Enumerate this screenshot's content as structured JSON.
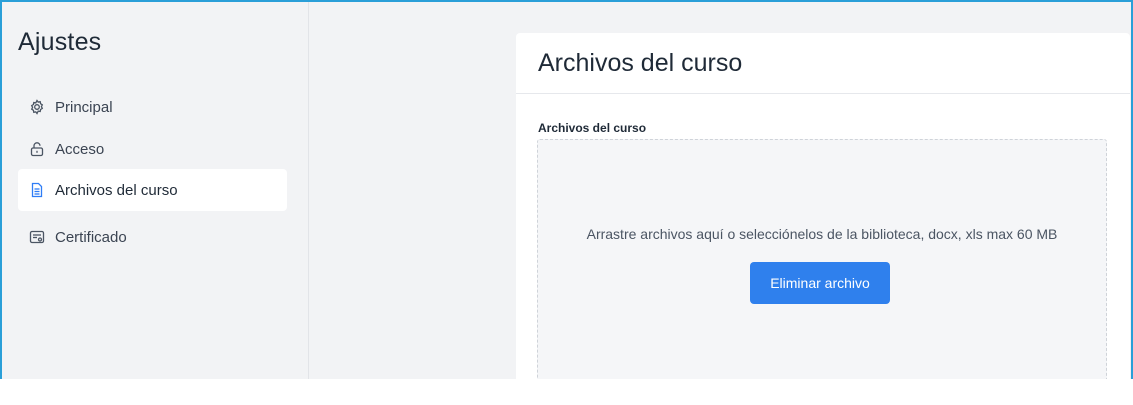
{
  "sidebar": {
    "title": "Ajustes",
    "items": [
      {
        "label": "Principal",
        "icon": "gear-icon",
        "active": false
      },
      {
        "label": "Acceso",
        "icon": "lock-icon",
        "active": false
      },
      {
        "label": "Archivos del curso",
        "icon": "document-icon",
        "active": true
      },
      {
        "label": "Certificado",
        "icon": "certificate-icon",
        "active": false
      }
    ]
  },
  "main": {
    "title": "Archivos del curso",
    "field_label": "Archivos del curso",
    "dropzone": {
      "text": "Arrastre archivos aquí o selecciónelos de la biblioteca, docx, xls max 60 MB",
      "button_label": "Eliminar archivo"
    }
  },
  "colors": {
    "accent": "#2f80ed",
    "frame_border": "#2a9fd8",
    "background": "#f2f3f5"
  }
}
